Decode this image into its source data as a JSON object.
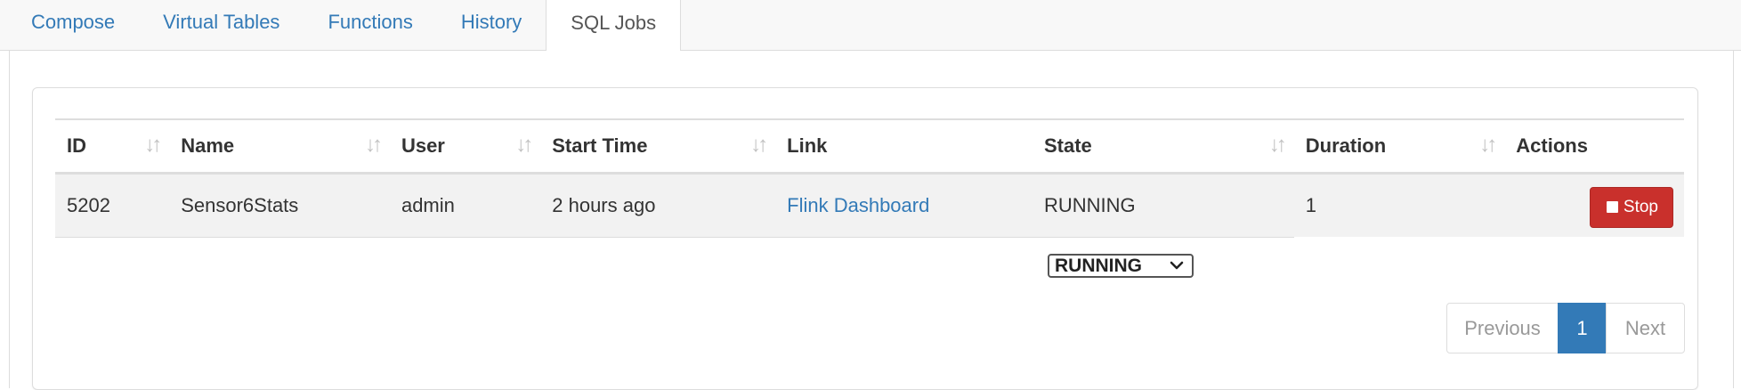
{
  "tabs": [
    {
      "label": "Compose"
    },
    {
      "label": "Virtual Tables"
    },
    {
      "label": "Functions"
    },
    {
      "label": "History"
    },
    {
      "label": "SQL Jobs"
    }
  ],
  "active_tab": "SQL Jobs",
  "table": {
    "columns": [
      "ID",
      "Name",
      "User",
      "Start Time",
      "Link",
      "State",
      "Duration",
      "Actions"
    ],
    "sortable_columns": [
      "ID",
      "Name",
      "User",
      "Start Time",
      "State",
      "Duration"
    ],
    "rows": [
      {
        "id": "5202",
        "name": "Sensor6Stats",
        "user": "admin",
        "start_time": "2 hours ago",
        "link": "Flink Dashboard",
        "state": "RUNNING",
        "duration": "1",
        "action_label": "Stop"
      }
    ]
  },
  "state_filter": {
    "selected": "RUNNING"
  },
  "pagination": {
    "previous_label": "Previous",
    "current_page": "1",
    "next_label": "Next"
  },
  "colors": {
    "link": "#337ab7",
    "danger": "#c9302c",
    "page_active": "#337ab7"
  }
}
